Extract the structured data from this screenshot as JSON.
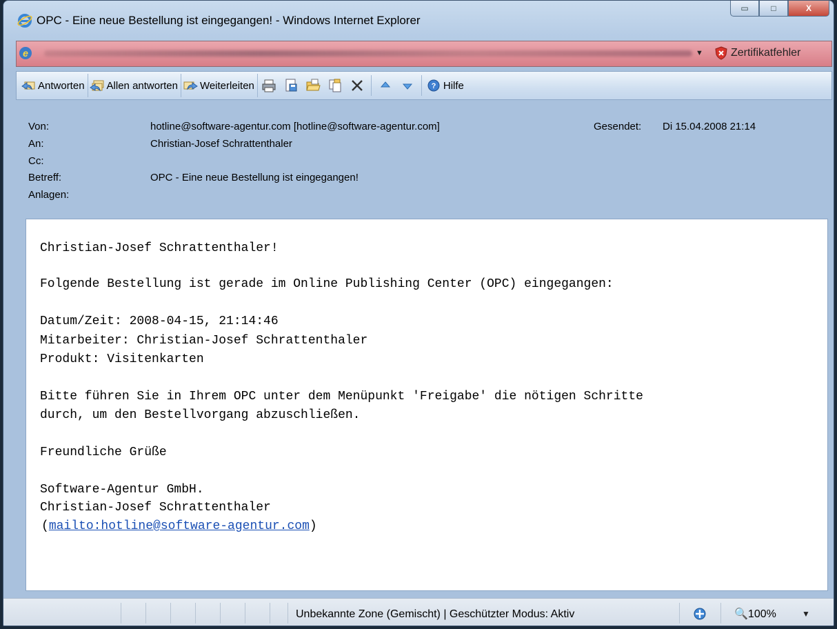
{
  "window": {
    "title": "OPC - Eine neue Bestellung ist eingegangen! - Windows Internet Explorer",
    "minimize_glyph": "▭",
    "maximize_glyph": "□",
    "close_glyph": "X"
  },
  "addressbar": {
    "cert_error_label": "Zertifikatfehler",
    "dropdown_glyph": "▼"
  },
  "toolbar": {
    "reply_label": "Antworten",
    "reply_all_label": "Allen antworten",
    "forward_label": "Weiterleiten",
    "help_label": "Hilfe",
    "icons": [
      "reply-icon",
      "reply-all-icon",
      "forward-icon",
      "print-icon",
      "save-icon",
      "open-folder-icon",
      "copy-icon",
      "delete-icon",
      "previous-icon",
      "next-icon",
      "help-icon"
    ]
  },
  "header": {
    "from_label": "Von:",
    "from_value": "hotline@software-agentur.com [hotline@software-agentur.com]",
    "to_label": "An:",
    "to_value": "Christian-Josef Schrattenthaler",
    "cc_label": "Cc:",
    "subject_label": "Betreff:",
    "subject_value": "OPC - Eine neue Bestellung ist eingegangen!",
    "attachments_label": "Anlagen:",
    "sent_label": "Gesendet:",
    "sent_value": "Di 15.04.2008 21:14"
  },
  "message": {
    "greeting": "Christian-Josef Schrattenthaler!",
    "intro": "Folgende Bestellung ist gerade im Online Publishing Center (OPC) eingegangen:",
    "datetime": "Datum/Zeit: 2008-04-15, 21:14:46",
    "employee": "Mitarbeiter: Christian-Josef Schrattenthaler",
    "product": "Produkt: Visitenkarten",
    "instruction_1": "Bitte führen Sie in Ihrem OPC unter dem Menüpunkt 'Freigabe' die nötigen Schritte",
    "instruction_2": "durch, um den Bestellvorgang abzuschließen.",
    "closing": "Freundliche Grüße",
    "company": "Software-Agentur GmbH.",
    "signature_name": "Christian-Josef Schrattenthaler",
    "paren_open": "(",
    "mailto_link": "mailto:hotline@software-agentur.com",
    "paren_close": ")"
  },
  "statusbar": {
    "zone_text": "Unbekannte Zone (Gemischt) | Geschützter Modus: Aktiv",
    "zoom_text": "100%",
    "zoom_dropdown_glyph": "▼"
  }
}
